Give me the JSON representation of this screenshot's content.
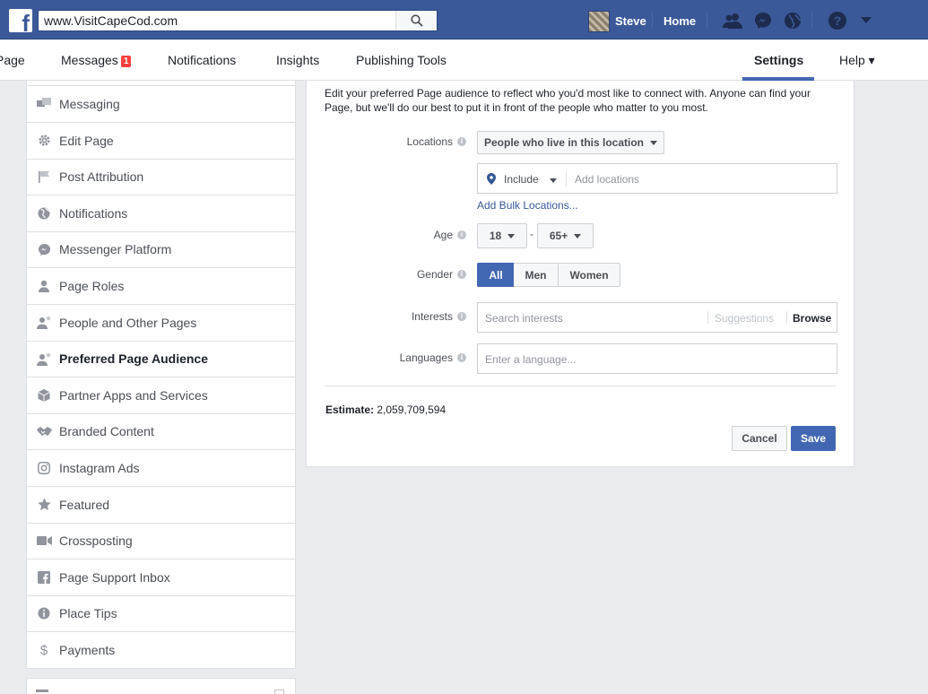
{
  "topbar": {
    "search_value": "www.VisitCapeCod.com",
    "user_name": "Steve",
    "home_label": "Home"
  },
  "pagenav": {
    "page_label": "Page",
    "messages_label": "Messages",
    "messages_badge": "1",
    "notifications_label": "Notifications",
    "insights_label": "Insights",
    "publishing_label": "Publishing Tools",
    "settings_label": "Settings",
    "help_label": "Help ▾"
  },
  "sidebar": {
    "items": [
      {
        "label": "Messaging",
        "icon": "messaging-icon"
      },
      {
        "label": "Edit Page",
        "icon": "gear-icon"
      },
      {
        "label": "Post Attribution",
        "icon": "flag-icon"
      },
      {
        "label": "Notifications",
        "icon": "globe-icon"
      },
      {
        "label": "Messenger Platform",
        "icon": "messenger-icon"
      },
      {
        "label": "Page Roles",
        "icon": "person-icon"
      },
      {
        "label": "People and Other Pages",
        "icon": "person-star-icon"
      },
      {
        "label": "Preferred Page Audience",
        "icon": "person-star-icon",
        "active": true
      },
      {
        "label": "Partner Apps and Services",
        "icon": "cube-icon"
      },
      {
        "label": "Branded Content",
        "icon": "handshake-icon"
      },
      {
        "label": "Instagram Ads",
        "icon": "instagram-icon"
      },
      {
        "label": "Featured",
        "icon": "star-icon"
      },
      {
        "label": "Crossposting",
        "icon": "video-icon"
      },
      {
        "label": "Page Support Inbox",
        "icon": "facebook-icon"
      },
      {
        "label": "Place Tips",
        "icon": "info-icon"
      },
      {
        "label": "Payments",
        "icon": "dollar-icon"
      }
    ]
  },
  "audience": {
    "intro": "Edit your preferred Page audience to reflect who you'd most like to connect with. Anyone can find your Page, but we'll do our best to put it in front of the people who matter to you most.",
    "locations_label": "Locations",
    "locations_select": "People who live in this location",
    "include_label": "Include",
    "add_locations_placeholder": "Add locations",
    "add_bulk_link": "Add Bulk Locations...",
    "age_label": "Age",
    "age_min": "18",
    "age_dash": "-",
    "age_max": "65+",
    "gender_label": "Gender",
    "gender_options": [
      "All",
      "Men",
      "Women"
    ],
    "gender_selected": "All",
    "interests_label": "Interests",
    "interests_placeholder": "Search interests",
    "suggestions_label": "Suggestions",
    "browse_label": "Browse",
    "languages_label": "Languages",
    "languages_placeholder": "Enter a language...",
    "estimate_label": "Estimate:",
    "estimate_value": "2,059,709,594",
    "cancel_label": "Cancel",
    "save_label": "Save"
  },
  "colors": {
    "brand_blue": "#3b5998",
    "primary_button": "#4267b2",
    "link": "#365899",
    "badge": "#fa3e3e"
  }
}
